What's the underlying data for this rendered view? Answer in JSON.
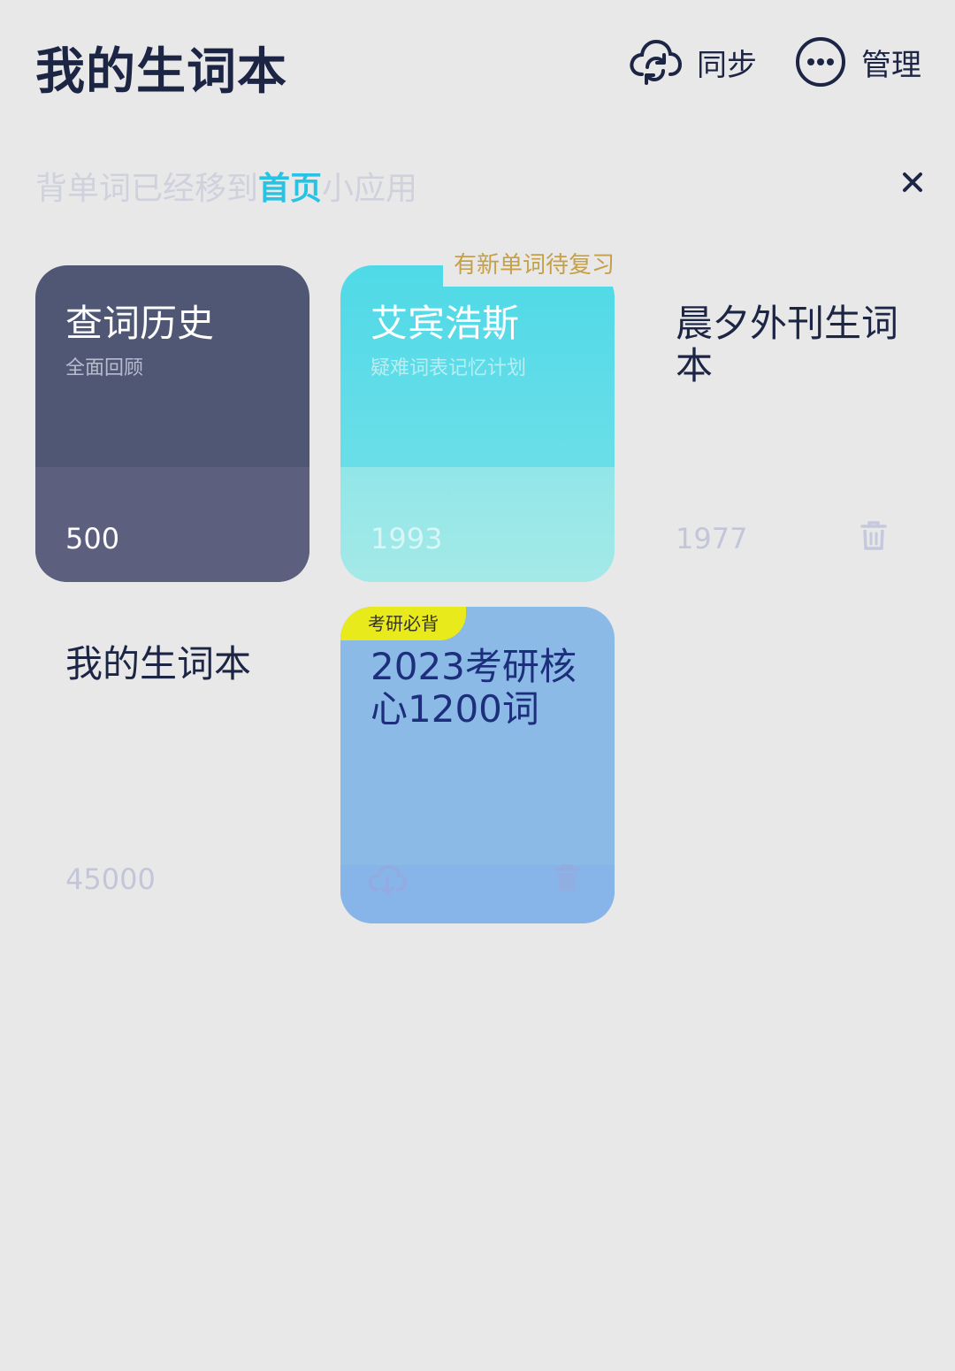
{
  "header": {
    "title": "我的生词本",
    "sync_label": "同步",
    "manage_label": "管理"
  },
  "notice": {
    "prefix": "背单词已经移到",
    "link": "首页",
    "suffix": "小应用"
  },
  "wordbooks": [
    {
      "title": "查词历史",
      "subtitle": "全面回顾",
      "count": "500"
    },
    {
      "title": "艾宾浩斯",
      "subtitle": "疑难词表记忆计划",
      "count": "1993",
      "tag": "有新单词待复习"
    },
    {
      "title": "晨夕外刊生词本",
      "count": "1977"
    },
    {
      "title": "我的生词本",
      "count": "45000"
    },
    {
      "title": "2023考研核心1200词",
      "tag": "考研必背"
    }
  ],
  "colors": {
    "background": "#e8e8e9",
    "title": "#1d2545",
    "link": "#27c3e4",
    "history_card": "#4f5775",
    "ebbinghaus_card": "#4fd9e7",
    "kaoyan_card": "#8bbae6",
    "kaoyan_tag": "#e9ea1c",
    "review_tag_text": "#c5a04a"
  },
  "icons": {
    "sync": "cloud-sync-icon",
    "manage": "more-dots-icon",
    "close": "close-icon",
    "delete": "trash-icon",
    "download": "cloud-download-icon"
  }
}
